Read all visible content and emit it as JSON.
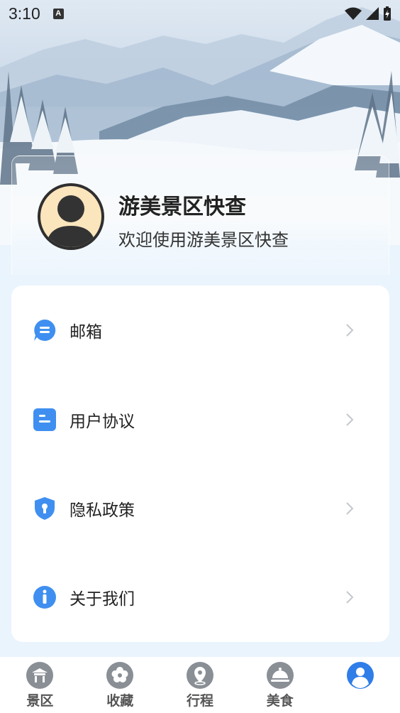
{
  "status_bar": {
    "time": "3:10",
    "notification_icon": "a-letter-icon",
    "icons": [
      "wifi-icon",
      "signal-icon",
      "battery-charging-icon"
    ]
  },
  "profile": {
    "app_name": "游美景区快查",
    "welcome": "欢迎使用游美景区快查",
    "avatar": "default-avatar"
  },
  "menu": [
    {
      "label": "邮箱",
      "icon": "mail-chat-icon"
    },
    {
      "label": "用户协议",
      "icon": "agreement-icon"
    },
    {
      "label": "隐私政策",
      "icon": "shield-lock-icon"
    },
    {
      "label": "关于我们",
      "icon": "info-icon"
    }
  ],
  "bottom_nav": [
    {
      "label": "景区",
      "icon": "scenic-gate-icon",
      "active": false
    },
    {
      "label": "收藏",
      "icon": "flower-icon",
      "active": false
    },
    {
      "label": "行程",
      "icon": "location-pin-icon",
      "active": false
    },
    {
      "label": "美食",
      "icon": "dish-cloche-icon",
      "active": false
    },
    {
      "label": "",
      "icon": "user-icon",
      "active": true
    }
  ],
  "colors": {
    "accent": "#3f8ff0",
    "nav_inactive": "#8a8f96",
    "background": "#eaf4fd"
  }
}
